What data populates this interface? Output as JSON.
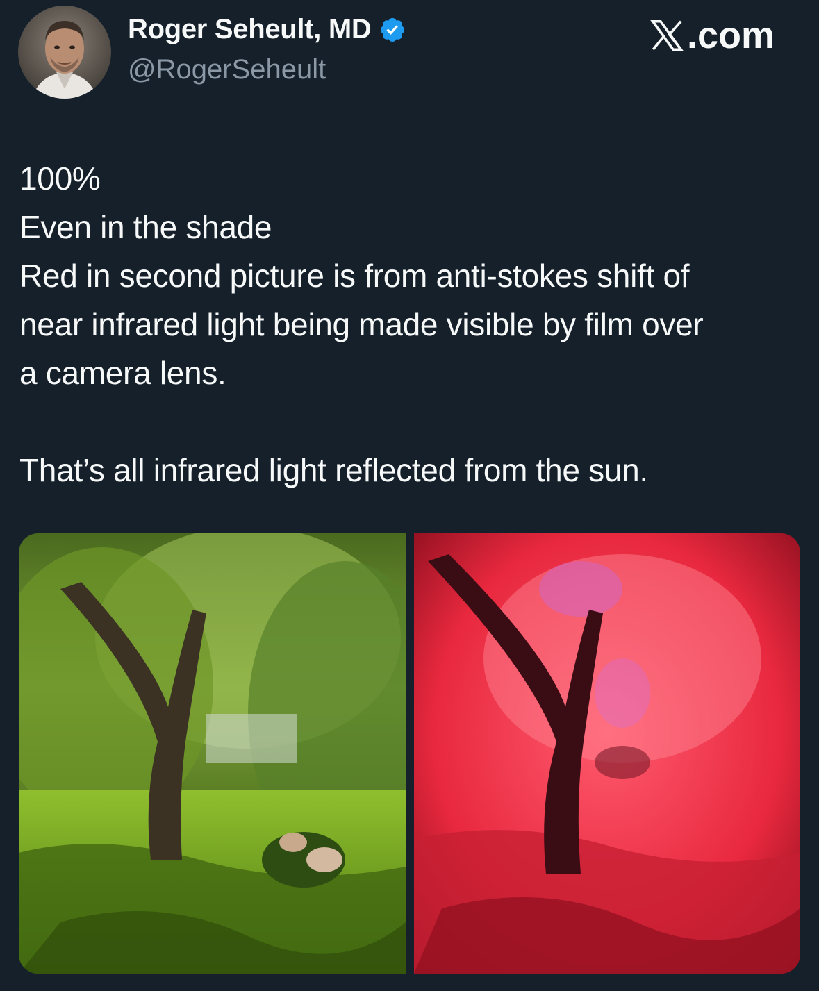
{
  "header": {
    "display_name": "Roger Seheult, MD",
    "handle": "@RogerSeheult",
    "verified_icon": "verified-badge-icon",
    "site_label": ".com",
    "site_logo_icon": "x-logo-icon"
  },
  "tweet": {
    "lines": [
      "100%",
      "Even in the shade",
      "Red in second picture is from anti-stokes shift of",
      "near infrared light being made visible by film over",
      "a camera lens.",
      "",
      "That’s all infrared light reflected from the sun."
    ]
  },
  "media": {
    "images": [
      {
        "subject": "willow-tree-garden-normal-photo",
        "tint": "#6f9a2a"
      },
      {
        "subject": "willow-tree-garden-infrared-photo",
        "tint": "#e8283e"
      }
    ]
  },
  "colors": {
    "background": "#15202b",
    "text": "#f7f9f9",
    "secondary_text": "#8b98a5",
    "verified_blue": "#1d9bf0"
  }
}
